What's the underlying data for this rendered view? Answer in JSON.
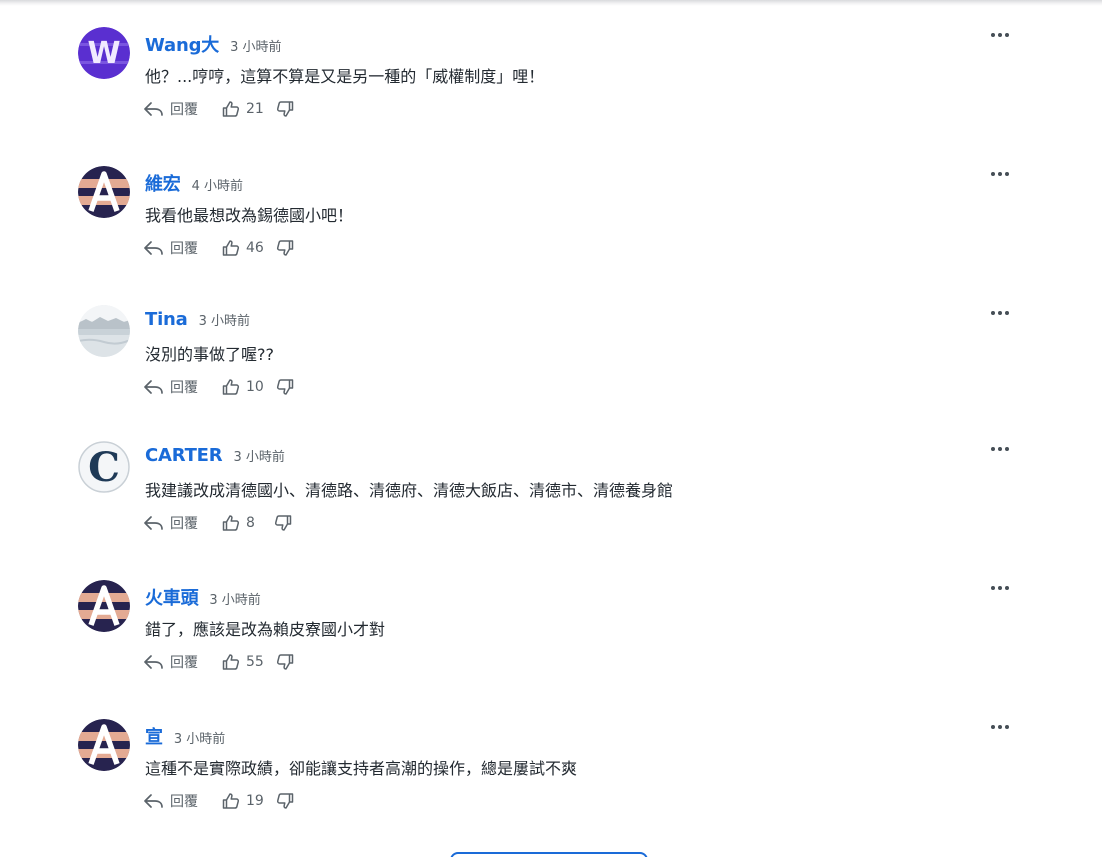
{
  "comments": [
    {
      "author": "Wang大",
      "time": "3 小時前",
      "text": "他？...哼哼，這算不算是又是另一種的「威權制度」哩！",
      "reply_label": "回覆",
      "likes": "21",
      "avatar": "w-purple"
    },
    {
      "author": "維宏",
      "time": "4 小時前",
      "text": "我看他最想改為錫德國小吧！",
      "reply_label": "回覆",
      "likes": "46",
      "avatar": "a-striped"
    },
    {
      "author": "Tina",
      "time": "3 小時前",
      "text": "沒別的事做了喔??",
      "reply_label": "回覆",
      "likes": "10",
      "avatar": "photo-landscape"
    },
    {
      "author": "CARTER",
      "time": "3 小時前",
      "text": "我建議改成清德國小、清德路、清德府、清德大飯店、清德市、清德養身館",
      "reply_label": "回覆",
      "likes": "8",
      "avatar": "c-letter"
    },
    {
      "author": "火車頭",
      "time": "3 小時前",
      "text": "錯了，應該是改為賴皮寮國小才對",
      "reply_label": "回覆",
      "likes": "55",
      "avatar": "a-striped"
    },
    {
      "author": "宣",
      "time": "3 小時前",
      "text": "這種不是實際政績，卻能讓支持者高潮的操作，總是屢試不爽",
      "reply_label": "回覆",
      "likes": "19",
      "avatar": "a-striped"
    }
  ],
  "icons": {
    "reply": "reply-icon",
    "like": "thumbs-up-icon",
    "dislike": "thumbs-down-icon",
    "more": "more-options-icon"
  },
  "colors": {
    "author": "#1a6bd8",
    "body_text": "#232a31",
    "meta": "#5b636a",
    "avatar_purple": "#5a2fd0",
    "avatar_navy": "#27234f",
    "avatar_peach": "#e3aa93"
  }
}
